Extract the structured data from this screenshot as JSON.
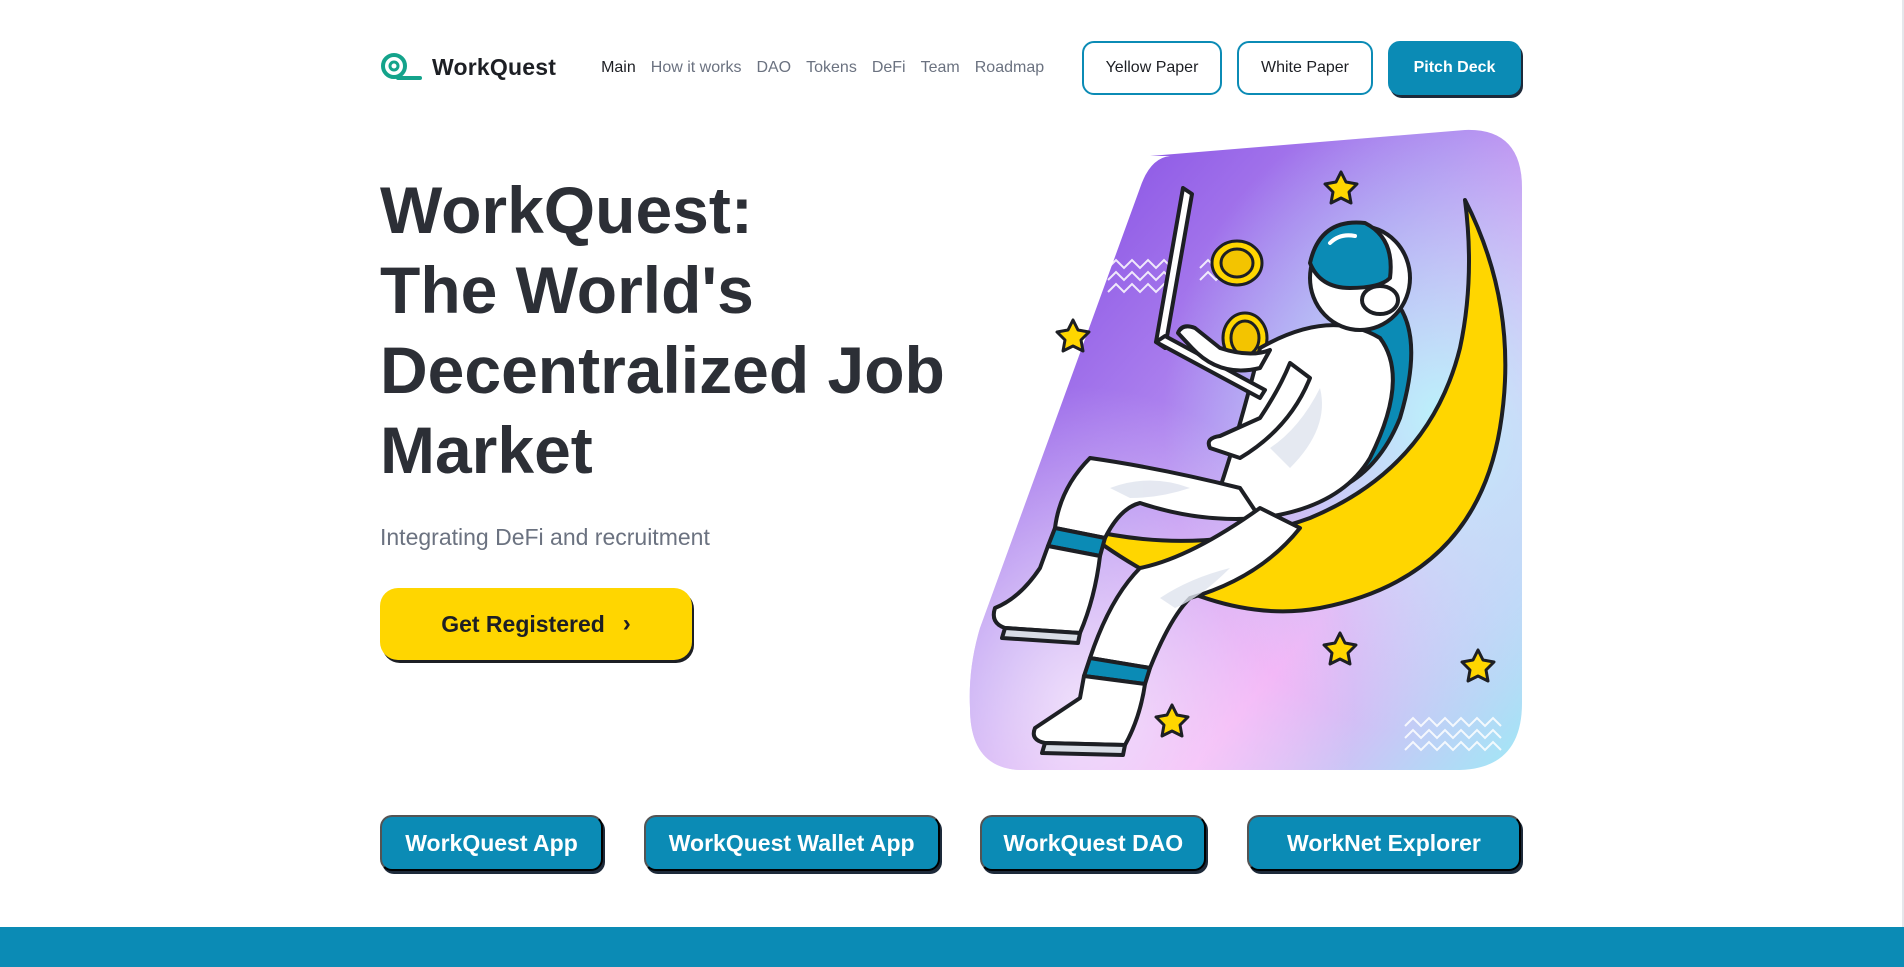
{
  "brand": {
    "name": "WorkQuest",
    "logo_icon": "workquest-logo-icon",
    "accent": "#0b8bb5",
    "yellow": "#ffd600"
  },
  "nav": {
    "items": [
      {
        "label": "Main",
        "active": true
      },
      {
        "label": "How it works"
      },
      {
        "label": "DAO"
      },
      {
        "label": "Tokens"
      },
      {
        "label": "DeFi"
      },
      {
        "label": "Team"
      },
      {
        "label": "Roadmap"
      }
    ]
  },
  "header_buttons": {
    "yellow_paper": "Yellow Paper",
    "white_paper": "White Paper",
    "pitch_deck": "Pitch Deck"
  },
  "hero": {
    "title_line1": "WorkQuest:",
    "title_line2": "The World's",
    "title_line3": "Decentralized Job",
    "title_line4": "Market",
    "subtitle": "Integrating DeFi and recruitment",
    "cta_label": "Get Registered",
    "cta_icon": "chevron-right-icon",
    "illustration": "astronaut-on-moon-illustration"
  },
  "app_links": {
    "app": "WorkQuest App",
    "wallet": "WorkQuest Wallet App",
    "dao": "WorkQuest DAO",
    "explorer": "WorkNet Explorer"
  }
}
